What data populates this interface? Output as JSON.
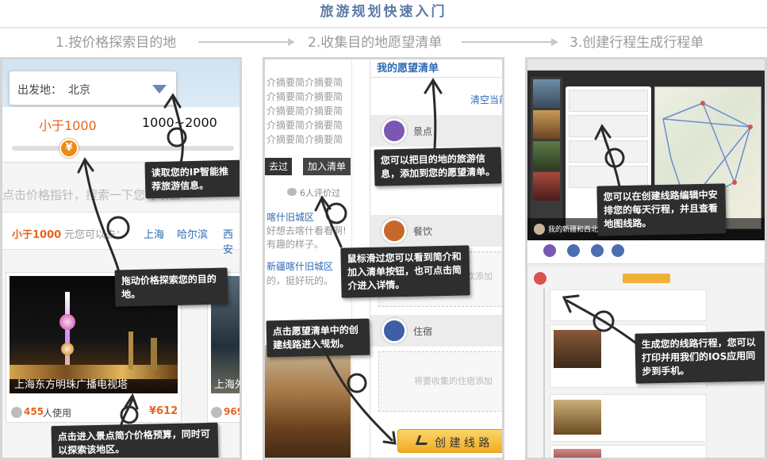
{
  "title": "旅游规划快速入门",
  "steps": [
    "1.按价格探索目的地",
    "2.收集目的地愿望清单",
    "3.创建行程生成行程单"
  ],
  "panel1": {
    "origin_label": "出发地：",
    "origin_value": "北京",
    "price_low": "小于1000",
    "price_mid": "1000~2000",
    "slider_symbol": "¥",
    "hint_text": "点击价格指针，搜索一下您可以去",
    "price_prefix": "小于1000",
    "price_suffix": "元您可以去：",
    "cities": [
      "上海",
      "哈尔滨",
      "西安"
    ],
    "card1_title": "上海东方明珠广播电视塔",
    "card1_users": "455",
    "card1_users_suffix": "人使用",
    "card1_price": "¥612",
    "card2_title": "上海外",
    "card2_users": "969",
    "callout_ip": "读取您的IP智能推荐旅游信息。",
    "callout_drag": "拖动价格探索您的目的地。",
    "callout_click": "点击进入景点简介价格预算，同时可以探索该地区。"
  },
  "panel2": {
    "wishlist_title": "我的愿望清单",
    "clear_link": "清空当前",
    "summary_text": "介摘要简介摘要简介摘要简介摘要简介摘要简介摘要简介摘要简介摘要简介摘要简介摘要简",
    "pass_button": "去过",
    "add_button": "加入清单",
    "review_text": "6人评价过",
    "item1_title": "喀什旧城区",
    "item1_desc": "好想去喀什看看啊!有趣的样子。",
    "item2_title": "新疆喀什旧城区",
    "item2_desc": "的，挺好玩的。",
    "cat_scenic": "景点",
    "cat_food": "餐饮",
    "cat_hotel": "住宿",
    "food_placeholder": "欢添加",
    "hotel_placeholder": "将要收集的住宿添加",
    "create_route": "创 建 线 路",
    "callout_wish": "您可以把目的地的旅游信息，添加到您的愿望清单。",
    "callout_hover": "鼠标滑过您可以看到简介和加入清单按钮，也可点击简介进入详情。",
    "callout_create": "点击愿望清单中的创建线路进入规划。"
  },
  "panel3": {
    "route_name": "我的新疆和西北之旅",
    "callout_edit": "您可以在创建线路编辑中安排您的每天行程，并且查看地图线路。",
    "callout_print": "生成您的线路行程，您可以打印并用我们的IOS应用同步到手机。"
  },
  "colors": {
    "accent": "#e8631c",
    "link": "#2e6bb3",
    "callout": "#2e2e2e",
    "title": "#5a79a6"
  }
}
